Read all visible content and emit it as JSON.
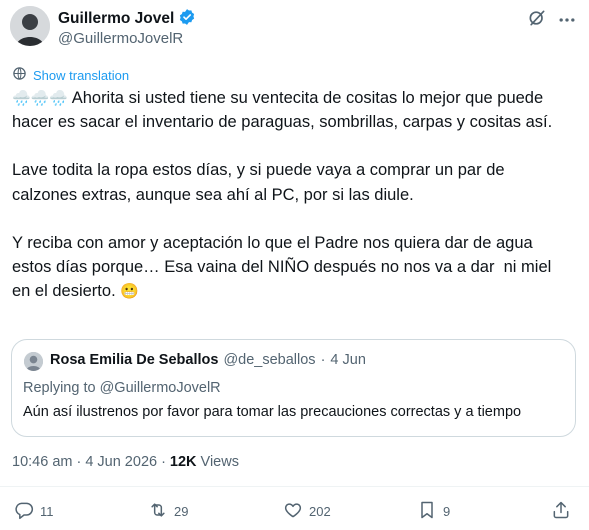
{
  "author": {
    "name": "Guillermo Jovel",
    "handle": "@GuillermoJovelR"
  },
  "icons": {
    "verified": "verified-badge-icon",
    "grok": "grok-icon",
    "more": "more-options-icon",
    "translate": "globe-translate-icon",
    "reply": "reply-icon",
    "repost": "repost-icon",
    "like": "like-icon",
    "bookmark": "bookmark-icon",
    "share": "share-icon"
  },
  "colors": {
    "accent": "#1d9bf0",
    "text": "#0f1419",
    "muted": "#536471",
    "border": "#cfd9de"
  },
  "translate_label": "Show translation",
  "tweet": {
    "line1_emoji": "🌧️🌧️🌧️",
    "line1": " Ahorita si usted tiene su ventecita de cositas lo mejor que puede hacer es sacar el inventario de paraguas, sombrillas, carpas y cositas así.",
    "para2": "Lave todita la ropa estos días, y si puede vaya a comprar un par de calzones extras, aunque sea ahí al PC, por si las diule.",
    "para3": "Y reciba con amor y aceptación lo que el Padre nos quiera dar de agua estos días porque… Esa vaina del NIÑO después no nos va a dar  ni miel en el desierto. ",
    "para3_emoji": "😬"
  },
  "quote": {
    "name": "Rosa Emilia De Seballos",
    "handle": "@de_seballos",
    "separator": "·",
    "date": "4 Jun",
    "replying_to": "Replying to @GuillermoJovelR",
    "text": "Aún así ilustrenos por favor para tomar las precauciones correctas y a tiempo"
  },
  "meta": {
    "time": "10:46 am",
    "separator": "·",
    "date": "4 Jun 2026",
    "separator2": "·",
    "views_count": "12K",
    "views_label": "Views"
  },
  "actions": {
    "replies": "11",
    "reposts": "29",
    "likes": "202",
    "bookmarks": "9"
  }
}
